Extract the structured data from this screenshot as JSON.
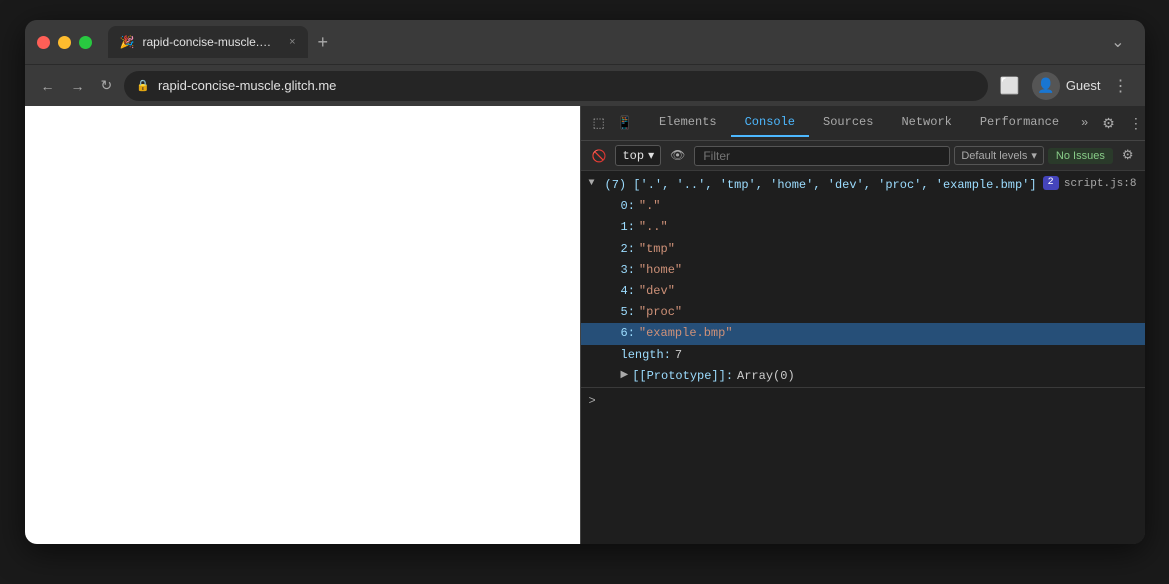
{
  "browser": {
    "traffic_lights": [
      "close",
      "minimize",
      "maximize"
    ],
    "tab": {
      "favicon": "🎉",
      "title": "rapid-concise-muscle.glitch.m…",
      "close_label": "×"
    },
    "new_tab_label": "+",
    "window_controls_label": "⌄",
    "address_bar": {
      "lock_icon": "🔒",
      "url": "rapid-concise-muscle.glitch.me"
    },
    "nav": {
      "back": "←",
      "forward": "→",
      "reload": "↻"
    },
    "account": {
      "label": "Guest"
    }
  },
  "devtools": {
    "tabs": [
      {
        "label": "Elements",
        "active": false
      },
      {
        "label": "Console",
        "active": true
      },
      {
        "label": "Sources",
        "active": false
      },
      {
        "label": "Network",
        "active": false
      },
      {
        "label": "Performance",
        "active": false
      }
    ],
    "more_tabs_label": "»",
    "toolbar": {
      "top_label": "top",
      "filter_placeholder": "Filter",
      "default_levels_label": "Default levels",
      "no_issues_label": "No Issues"
    },
    "console": {
      "array_summary": "(7) ['.', '..', 'tmp', 'home', 'dev', 'proc', 'example.bmp']",
      "badge_num": "2",
      "source_link": "script.js:8",
      "items": [
        {
          "key": "0:",
          "value": "\".\"",
          "highlighted": false
        },
        {
          "key": "1:",
          "value": "\"..\"",
          "highlighted": false
        },
        {
          "key": "2:",
          "value": "\"tmp\"",
          "highlighted": false
        },
        {
          "key": "3:",
          "value": "\"home\"",
          "highlighted": false
        },
        {
          "key": "4:",
          "value": "\"dev\"",
          "highlighted": false
        },
        {
          "key": "5:",
          "value": "\"proc\"",
          "highlighted": false
        },
        {
          "key": "6:",
          "value": "\"example.bmp\"",
          "highlighted": true
        }
      ],
      "length_key": "length:",
      "length_val": "7",
      "prototype_label": "[[Prototype]]:",
      "prototype_val": "Array(0)"
    },
    "input_prompt": ">"
  }
}
